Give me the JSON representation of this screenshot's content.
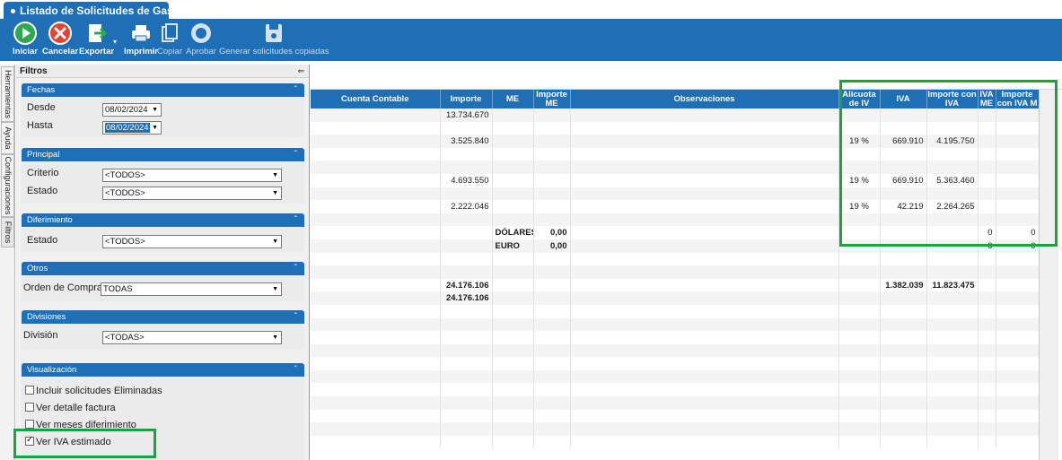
{
  "window": {
    "tab_title": "Listado de Solicitudes de Gastos"
  },
  "toolbar": {
    "iniciar": "Iniciar",
    "cancelar": "Cancelar",
    "exportar": "Exportar",
    "imprimir": "Imprimir",
    "copiar": "Copiar",
    "aprobar": "Aprobar",
    "generar": "Generar solicitudes copiadas"
  },
  "side_tabs": [
    "Herramientas",
    "Ayuda",
    "Configuraciones",
    "Filtros"
  ],
  "filters": {
    "title": "Filtros",
    "fechas": {
      "title": "Fechas",
      "desde_label": "Desde",
      "desde_value": "08/02/2024",
      "hasta_label": "Hasta",
      "hasta_value": "08/02/2024"
    },
    "principal": {
      "title": "Principal",
      "criterio_label": "Criterio",
      "criterio_value": "<TODOS>",
      "estado_label": "Estado",
      "estado_value": "<TODOS>"
    },
    "diferimiento": {
      "title": "Diferimiento",
      "estado_label": "Estado",
      "estado_value": "<TODOS>"
    },
    "otros": {
      "title": "Otros",
      "oc_label": "Orden de Compra",
      "oc_value": "TODAS"
    },
    "divisiones": {
      "title": "Divisiones",
      "division_label": "División",
      "division_value": "<TODAS>"
    },
    "visualizacion": {
      "title": "Visualización",
      "options": [
        {
          "label": "Incluir solicitudes Eliminadas",
          "checked": false
        },
        {
          "label": "Ver detalle factura",
          "checked": false
        },
        {
          "label": "Ver meses diferimiento",
          "checked": false
        },
        {
          "label": "Ver IVA estimado",
          "checked": true
        }
      ]
    }
  },
  "grid": {
    "headers": [
      "Cuenta Contable",
      "Importe",
      "ME",
      "Importe ME",
      "Observaciones",
      "Alicuota de IV",
      "IVA",
      "Importe con IVA",
      "IVA ME",
      "Importe con IVA M"
    ],
    "rows": [
      [
        "",
        "13.734.670",
        "",
        "",
        "",
        "",
        "",
        "",
        "",
        ""
      ],
      [
        "",
        "",
        "",
        "",
        "",
        "",
        "",
        "",
        "",
        ""
      ],
      [
        "",
        "3.525.840",
        "",
        "",
        "",
        "19 %",
        "669.910",
        "4.195.750",
        "",
        ""
      ],
      [
        "",
        "",
        "",
        "",
        "",
        "",
        "",
        "",
        "",
        ""
      ],
      [
        "",
        "",
        "",
        "",
        "",
        "",
        "",
        "",
        "",
        ""
      ],
      [
        "",
        "4.693.550",
        "",
        "",
        "",
        "19 %",
        "669.910",
        "5.363.460",
        "",
        ""
      ],
      [
        "",
        "",
        "",
        "",
        "",
        "",
        "",
        "",
        "",
        ""
      ],
      [
        "",
        "2.222.046",
        "",
        "",
        "",
        "19 %",
        "42.219",
        "2.264.265",
        "",
        ""
      ],
      [
        "",
        "",
        "",
        "",
        "",
        "",
        "",
        "",
        "",
        ""
      ],
      [
        "",
        "",
        "DÓLARES",
        "0,00",
        "",
        "",
        "",
        "",
        "0",
        "0"
      ],
      [
        "",
        "",
        "EURO",
        "0,00",
        "",
        "",
        "",
        "",
        "0",
        "0"
      ],
      [
        "",
        "",
        "",
        "",
        "",
        "",
        "",
        "",
        "",
        ""
      ],
      [
        "",
        "",
        "",
        "",
        "",
        "",
        "",
        "",
        "",
        ""
      ],
      [
        "",
        "24.176.106",
        "",
        "",
        "",
        "",
        "1.382.039",
        "11.823.475",
        "",
        ""
      ],
      [
        "",
        "24.176.106",
        "",
        "",
        "",
        "",
        "",
        "",
        "",
        ""
      ],
      [
        "",
        "",
        "",
        "",
        "",
        "",
        "",
        "",
        "",
        ""
      ],
      [
        "",
        "",
        "",
        "",
        "",
        "",
        "",
        "",
        "",
        ""
      ],
      [
        "",
        "",
        "",
        "",
        "",
        "",
        "",
        "",
        "",
        ""
      ],
      [
        "",
        "",
        "",
        "",
        "",
        "",
        "",
        "",
        "",
        ""
      ],
      [
        "",
        "",
        "",
        "",
        "",
        "",
        "",
        "",
        "",
        ""
      ],
      [
        "",
        "",
        "",
        "",
        "",
        "",
        "",
        "",
        "",
        ""
      ],
      [
        "",
        "",
        "",
        "",
        "",
        "",
        "",
        "",
        "",
        ""
      ],
      [
        "",
        "",
        "",
        "",
        "",
        "",
        "",
        "",
        "",
        ""
      ],
      [
        "",
        "",
        "",
        "",
        "",
        "",
        "",
        "",
        "",
        ""
      ],
      [
        "",
        "",
        "",
        "",
        "",
        "",
        "",
        "",
        "",
        ""
      ],
      [
        "",
        "",
        "",
        "",
        "",
        "",
        "",
        "",
        "",
        ""
      ]
    ]
  },
  "colors": {
    "accent": "#1e6fb5",
    "highlight": "#1aa33a"
  }
}
